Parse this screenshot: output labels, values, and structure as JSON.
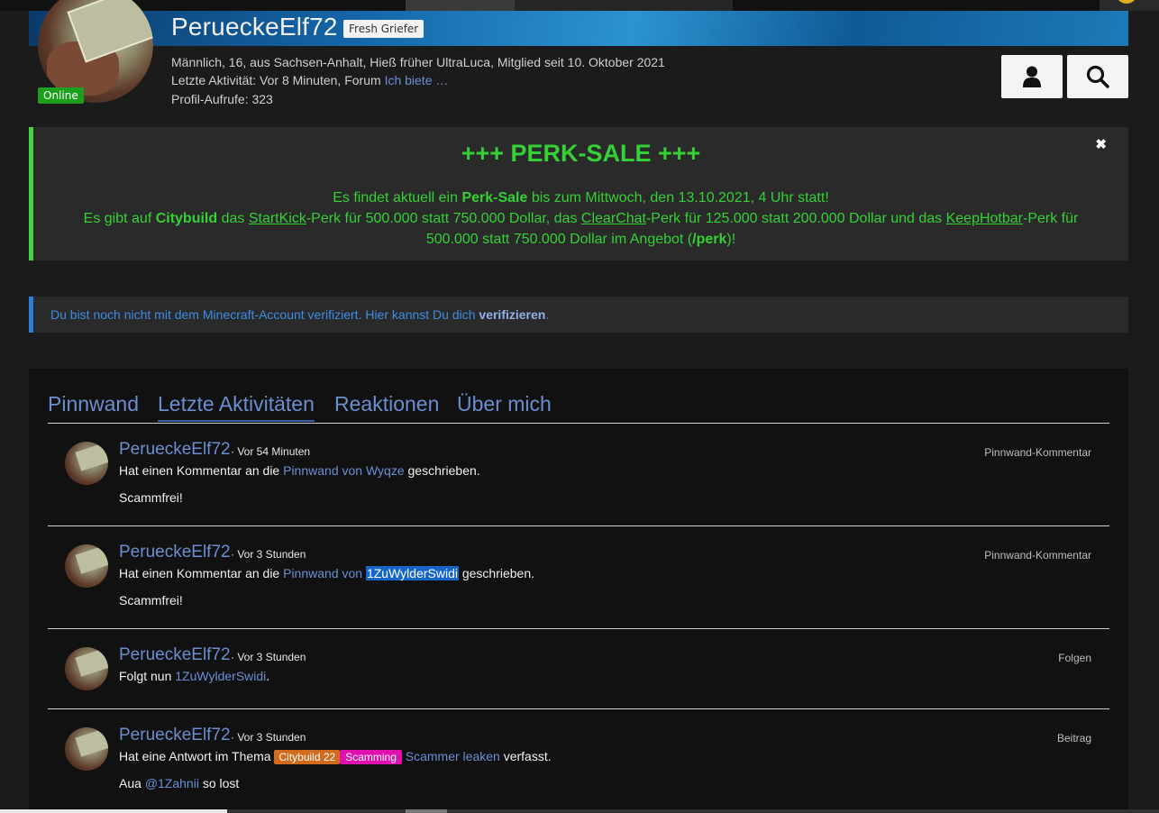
{
  "profile": {
    "username": "PerueckeElf72",
    "rank": "Fresh Griefer",
    "online": "Online",
    "info_prefix": "Männlich, 16, aus Sachsen-Anhalt, Hieß früher UltraLuca, Mitglied seit 10. Oktober 2021",
    "activity_prefix": "Letzte Aktivität: Vor 8 Minuten, Forum",
    "activity_link": "Ich biete …",
    "views": "Profil-Aufrufe: 323"
  },
  "buttons": {
    "profile_icon": "user-icon",
    "search_icon": "search-icon"
  },
  "sale": {
    "title": "+++ PERK-SALE +++",
    "line1_a": "Es findet aktuell ein ",
    "line1_b": "Perk-Sale",
    "line1_c": " bis zum Mittwoch, den 13.10.2021, 4 Uhr statt!",
    "line2_a": "Es gibt auf ",
    "line2_b": "Citybuild",
    "line2_c": " das ",
    "line2_d": "StartKick",
    "line2_e": "-Perk für 500.000 statt 750.000 Dollar, das ",
    "line2_f": "ClearChat",
    "line2_g": "-Perk für 125.000 statt 200.000 Dollar und das ",
    "line2_h": "KeepHotbar",
    "line2_i": "-Perk für",
    "line3_a": "500.000 statt 750.000 Dollar im Angebot (",
    "line3_b": "/perk",
    "line3_c": ")!",
    "close": "✖"
  },
  "verify": {
    "text": "Du bist noch nicht mit dem Minecraft-Account verifiziert. Hier kannst Du dich ",
    "link": "verifizieren",
    "suffix": "."
  },
  "tabs": [
    "Pinnwand",
    "Letzte Aktivitäten",
    "Reaktionen",
    "Über mich"
  ],
  "items": [
    {
      "user": "PerueckeElf72",
      "time": "· Vor 54 Minuten",
      "type": "Pinnwand-Kommentar",
      "desc_a": "Hat einen Kommentar an die ",
      "desc_link": "Pinnwand von Wyqze",
      "desc_b": " geschrieben.",
      "content": "Scammfrei!"
    },
    {
      "user": "PerueckeElf72",
      "time": "· Vor 3 Stunden",
      "type": "Pinnwand-Kommentar",
      "desc_a": "Hat einen Kommentar an die ",
      "desc_link": "Pinnwand von ",
      "desc_hl": "1ZuWylderSwidi",
      "desc_b": " geschrieben.",
      "content": "Scammfrei!"
    },
    {
      "user": "PerueckeElf72",
      "time": "· Vor 3 Stunden",
      "type": "Folgen",
      "desc_a": "Folgt nun ",
      "desc_link": "1ZuWylderSwidi",
      "desc_b": "."
    },
    {
      "user": "PerueckeElf72",
      "time": "· Vor 3 Stunden",
      "type": "Beitrag",
      "desc_a": "Hat eine Antwort im Thema ",
      "label1": "Citybuild 22",
      "label2": "Scamming",
      "desc_link": "Scammer leaken",
      "desc_b": " verfasst.",
      "content_a": "Aua ",
      "content_mention": "@1Zahnii",
      "content_b": " so lost"
    }
  ],
  "colors": {
    "accent_green": "#35d035",
    "link_blue": "#6b8ed0",
    "highlight": "#1666c8",
    "label_orange": "#d26b1e",
    "label_pink": "#e010b0"
  }
}
